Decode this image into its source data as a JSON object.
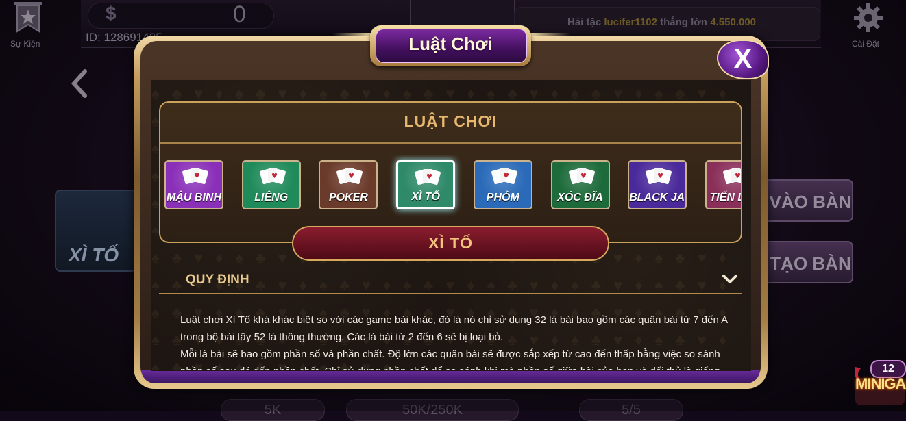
{
  "background": {
    "events_label": "Sự Kiện",
    "settings_label": "Cài Đặt",
    "balance": "0",
    "player_id": "ID: 128691425",
    "ticker": {
      "prefix": "Hải tặc",
      "user": "lucifer1102",
      "middle": "thắng lớn",
      "amount": "4.550.000"
    },
    "featured_game": "XÌ TỐ",
    "join_button": "VÀO BÀN",
    "create_button": "TẠO BÀN",
    "bottom_left": "5K",
    "bottom_mid": "50K/250K",
    "bottom_right": "5/5",
    "minigame_count": "12",
    "minigame_label": "MINIGAM"
  },
  "modal": {
    "title": "Luật Chơi",
    "close_label": "X",
    "panel_title": "LUẬT CHƠI",
    "games": [
      {
        "label": "MẬU BINH",
        "bg": "#8a2fb8",
        "active": false
      },
      {
        "label": "LIÊNG",
        "bg": "#1f8a5a",
        "active": false
      },
      {
        "label": "POKER",
        "bg": "#6a3a2a",
        "active": false
      },
      {
        "label": "XÌ TỐ",
        "bg": "#2f8a6a",
        "active": true
      },
      {
        "label": "PHỎM",
        "bg": "#2a6ab8",
        "active": false
      },
      {
        "label": "XÓC ĐĨA",
        "bg": "#1d6b3a",
        "active": false
      },
      {
        "label": "BLACK JACK",
        "bg": "#4a2a9a",
        "active": false
      },
      {
        "label": "TIẾN LÊN",
        "bg": "#8a2f5a",
        "active": false
      }
    ],
    "selected_game": "XÌ TỐ",
    "rules_heading": "QUY ĐỊNH",
    "rules_paragraphs": [
      "Luật chơi Xì Tố khá khác biệt so với các game bài khác, đó là nó chỉ sử dụng 32 lá bài bao gồm các quân bài từ 7 đến A trong bộ bài tây 52 lá thông thường. Các lá bài từ 2 đến 6 sẽ bị loại bỏ.",
      "Mỗi lá bài sẽ bao gồm phần số và phần chất. Độ lớn các quân bài sẽ được sắp xếp từ cao đến thấp bằng việc so sánh phần số sau đó đến phần chất. Chỉ sử dụng phần chất để so sánh khi mà phần số giữa bài của bạn và đối thủ là giống nhau."
    ]
  }
}
